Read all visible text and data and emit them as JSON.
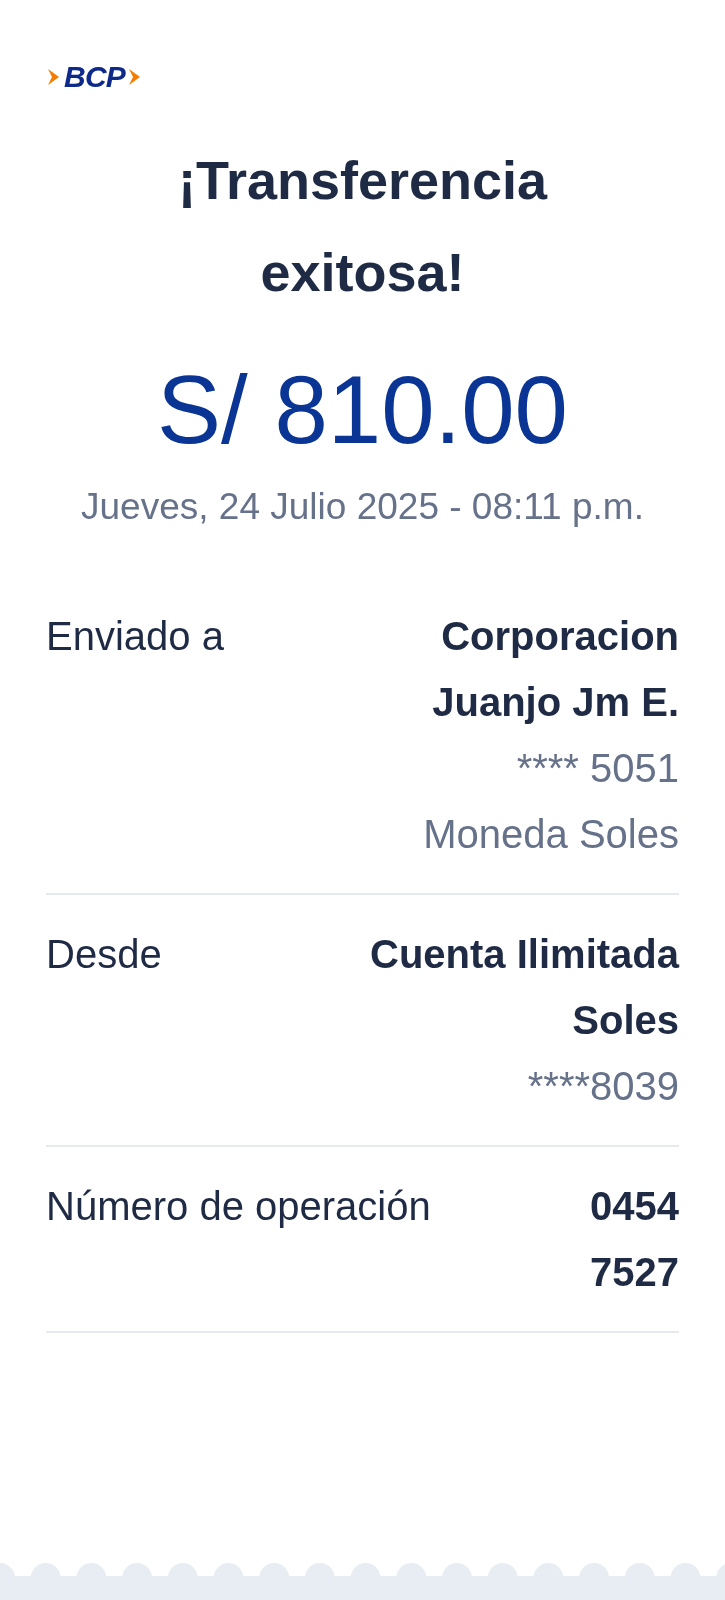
{
  "logo": {
    "text": "BCP"
  },
  "title": "¡Transferencia exitosa!",
  "amount": "S/ 810.00",
  "date": "Jueves, 24 Julio 2025 - 08:11 p.m.",
  "details": [
    {
      "label": "Enviado a",
      "value": "Corporacion Juanjo Jm E.",
      "extra": [
        "**** 5051",
        "Moneda Soles"
      ]
    },
    {
      "label": "Desde",
      "value": "Cuenta Ilimitada Soles",
      "extra": [
        "****8039"
      ]
    },
    {
      "label": "Número de operación",
      "value": "0454 7527"
    }
  ]
}
